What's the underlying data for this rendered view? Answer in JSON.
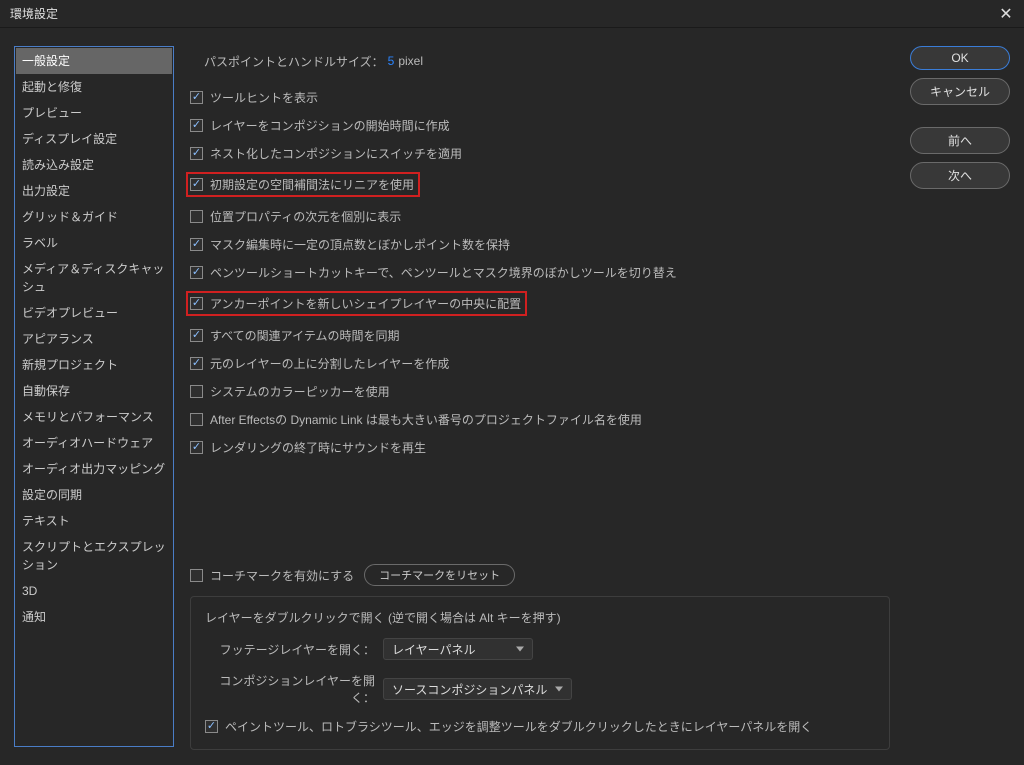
{
  "titlebar": {
    "title": "環境設定"
  },
  "sidebar": {
    "items": [
      {
        "label": "一般設定",
        "selected": true
      },
      {
        "label": "起動と修復"
      },
      {
        "label": "プレビュー"
      },
      {
        "label": "ディスプレイ設定"
      },
      {
        "label": "読み込み設定"
      },
      {
        "label": "出力設定"
      },
      {
        "label": "グリッド＆ガイド"
      },
      {
        "label": "ラベル"
      },
      {
        "label": "メディア＆ディスクキャッシュ"
      },
      {
        "label": "ビデオプレビュー"
      },
      {
        "label": "アピアランス"
      },
      {
        "label": "新規プロジェクト"
      },
      {
        "label": "自動保存"
      },
      {
        "label": "メモリとパフォーマンス"
      },
      {
        "label": "オーディオハードウェア"
      },
      {
        "label": "オーディオ出力マッピング"
      },
      {
        "label": "設定の同期"
      },
      {
        "label": "テキスト"
      },
      {
        "label": "スクリプトとエクスプレッション"
      },
      {
        "label": "3D"
      },
      {
        "label": "通知"
      }
    ]
  },
  "settings": {
    "path_label": "パスポイントとハンドルサイズ：",
    "path_value": "5",
    "path_unit": "pixel",
    "checks": [
      {
        "label": "ツールヒントを表示",
        "checked": true,
        "hl": false
      },
      {
        "label": "レイヤーをコンポジションの開始時間に作成",
        "checked": true,
        "hl": false
      },
      {
        "label": "ネスト化したコンポジションにスイッチを適用",
        "checked": true,
        "hl": false
      },
      {
        "label": "初期設定の空間補間法にリニアを使用",
        "checked": true,
        "hl": true
      },
      {
        "label": "位置プロパティの次元を個別に表示",
        "checked": false,
        "hl": false
      },
      {
        "label": "マスク編集時に一定の頂点数とぼかしポイント数を保持",
        "checked": true,
        "hl": false
      },
      {
        "label": "ペンツールショートカットキーで、ペンツールとマスク境界のぼかしツールを切り替え",
        "checked": true,
        "hl": false
      },
      {
        "label": "アンカーポイントを新しいシェイプレイヤーの中央に配置",
        "checked": true,
        "hl": true
      },
      {
        "label": "すべての関連アイテムの時間を同期",
        "checked": true,
        "hl": false
      },
      {
        "label": "元のレイヤーの上に分割したレイヤーを作成",
        "checked": true,
        "hl": false
      },
      {
        "label": "システムのカラーピッカーを使用",
        "checked": false,
        "hl": false
      },
      {
        "label": "After Effectsの Dynamic Link は最も大きい番号のプロジェクトファイル名を使用",
        "checked": false,
        "hl": false
      },
      {
        "label": "レンダリングの終了時にサウンドを再生",
        "checked": true,
        "hl": false
      }
    ],
    "coach": {
      "label": "コーチマークを有効にする",
      "checked": false,
      "reset": "コーチマークをリセット"
    },
    "group": {
      "title": "レイヤーをダブルクリックで開く (逆で開く場合は Alt キーを押す)",
      "footage_label": "フッテージレイヤーを開く：",
      "footage_value": "レイヤーパネル",
      "comp_label": "コンポジションレイヤーを開く：",
      "comp_value": "ソースコンポジションパネル",
      "paint": {
        "checked": true,
        "label": "ペイントツール、ロトブラシツール、エッジを調整ツールをダブルクリックしたときにレイヤーパネルを開く"
      }
    }
  },
  "buttons": {
    "ok": "OK",
    "cancel": "キャンセル",
    "prev": "前へ",
    "next": "次へ"
  }
}
